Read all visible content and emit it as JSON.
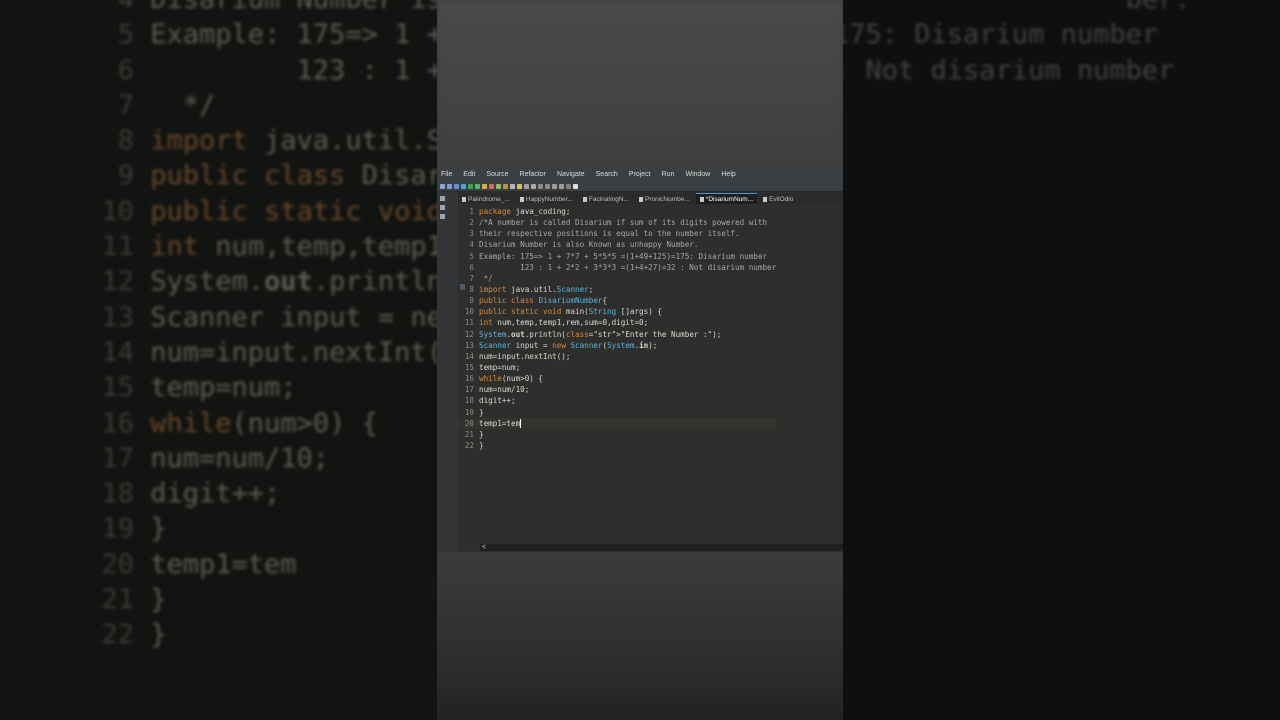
{
  "menu": [
    "File",
    "Edit",
    "Source",
    "Refactor",
    "Navigate",
    "Search",
    "Project",
    "Run",
    "Window",
    "Help"
  ],
  "tabs": [
    {
      "label": "Palindrome_...",
      "active": false
    },
    {
      "label": "HappyNumber...",
      "active": false
    },
    {
      "label": "FacinatingN...",
      "active": false
    },
    {
      "label": "PronicNumbe...",
      "active": false
    },
    {
      "label": "*DisariumNum...",
      "active": true
    },
    {
      "label": "EvilOdio",
      "active": false
    }
  ],
  "code": [
    {
      "n": "1",
      "t": "package java_coding;",
      "c": "txt"
    },
    {
      "n": "2",
      "t": "/*A number is called Disarium if sum of its digits powered with",
      "c": "cm"
    },
    {
      "n": "3",
      "t": "their respective positions is equal to the number itself.",
      "c": "cm"
    },
    {
      "n": "4",
      "t": "Disarium Number is also Known as unhappy Number.",
      "c": "cm"
    },
    {
      "n": "5",
      "t": "Example: 175=> 1 + 7*7 + 5*5*5 =(1+49+125)=175: Disarium number",
      "c": "cm"
    },
    {
      "n": "6",
      "t": "         123 : 1 + 2*2 + 3*3*3 =(1+4+27)=32 : Not disarium number",
      "c": "cm"
    },
    {
      "n": "7",
      "t": " */",
      "c": "cm"
    },
    {
      "n": "8",
      "t": "import java.util.Scanner;",
      "c": "txt"
    },
    {
      "n": "9",
      "t": "public class DisariumNumber{",
      "c": "txt"
    },
    {
      "n": "10",
      "t": "public static void main(String []args) {",
      "c": "txt"
    },
    {
      "n": "11",
      "t": "int num,temp,temp1,rem,sum=0,digit=0;",
      "c": "txt"
    },
    {
      "n": "12",
      "t": "System.out.println(\"Enter the Number :\");",
      "c": "txt"
    },
    {
      "n": "13",
      "t": "Scanner input = new Scanner(System.in);",
      "c": "txt"
    },
    {
      "n": "14",
      "t": "num=input.nextInt();",
      "c": "txt"
    },
    {
      "n": "15",
      "t": "temp=num;",
      "c": "txt"
    },
    {
      "n": "16",
      "t": "while(num>0) {",
      "c": "txt"
    },
    {
      "n": "17",
      "t": "num=num/10;",
      "c": "txt"
    },
    {
      "n": "18",
      "t": "digit++;",
      "c": "txt"
    },
    {
      "n": "19",
      "t": "}",
      "c": "txt"
    },
    {
      "n": "20",
      "t": "temp1=tem",
      "c": "txt"
    },
    {
      "n": "21",
      "t": "}",
      "c": "txt"
    },
    {
      "n": "22",
      "t": "}",
      "c": "txt"
    }
  ],
  "scroll_label": "<",
  "colors": {
    "keyword": "#d58a3a",
    "string": "#e6db74",
    "comment": "#a6a6a6",
    "class": "#5cb3d6"
  }
}
